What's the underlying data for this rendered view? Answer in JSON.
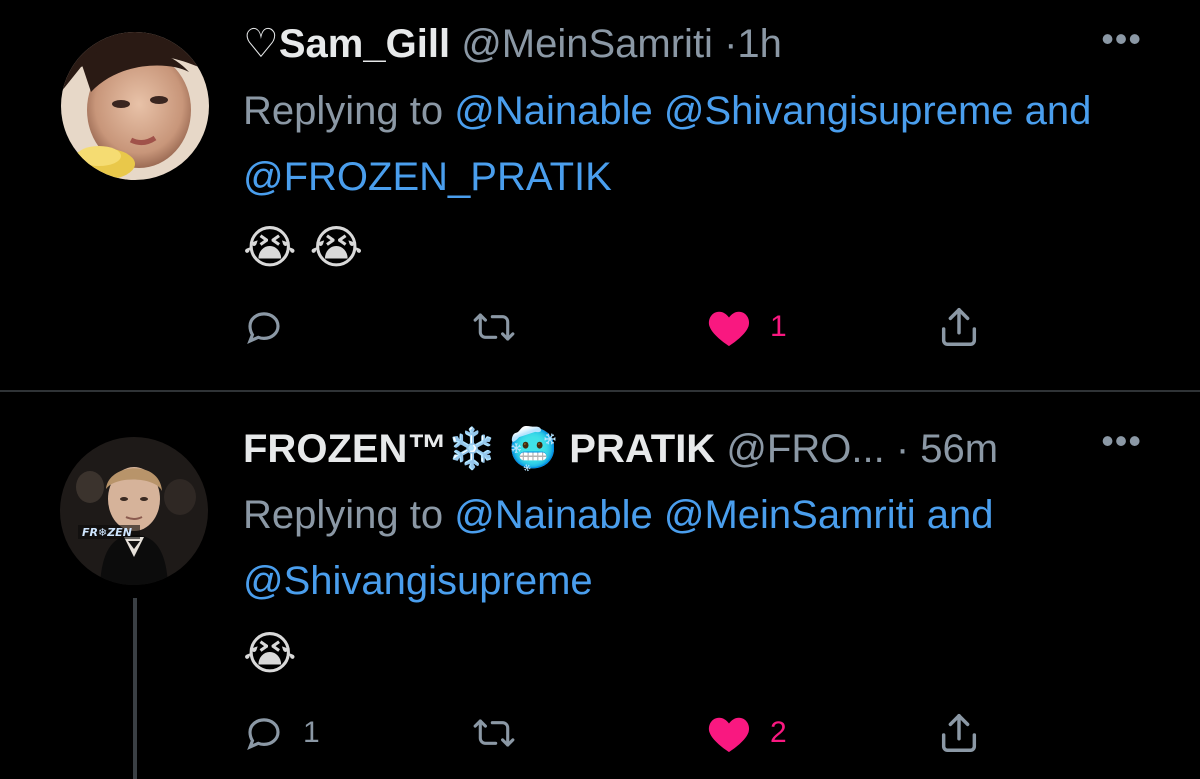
{
  "tweets": [
    {
      "display_name": "♡Sam_Gill",
      "handle": "@MeinSamriti",
      "separator": "·",
      "time": "1h",
      "reply_prefix": "Replying to",
      "mentions": [
        "@Nainable",
        "@Shivangisupreme",
        "@FROZEN_PRATIK"
      ],
      "connector": "and",
      "body": "😭 😭",
      "reply_count": "",
      "retweet_count": "",
      "like_count": "1",
      "liked": true
    },
    {
      "display_name": "FROZEN™❄️ 🥶 PRATIK",
      "handle": "@FRO...",
      "separator": "·",
      "time": "56m",
      "reply_prefix": "Replying to",
      "mentions": [
        "@Nainable",
        "@MeinSamriti",
        "@Shivangisupreme"
      ],
      "connector": "and",
      "body": "😭",
      "reply_count": "1",
      "retweet_count": "",
      "like_count": "2",
      "liked": true
    }
  ],
  "more_label": "•••",
  "colors": {
    "link": "#4a9eed",
    "like": "#f91880",
    "muted": "#8b98a5",
    "background": "#000000"
  },
  "icons": [
    "reply-icon",
    "retweet-icon",
    "heart-icon",
    "share-icon",
    "more-icon"
  ]
}
